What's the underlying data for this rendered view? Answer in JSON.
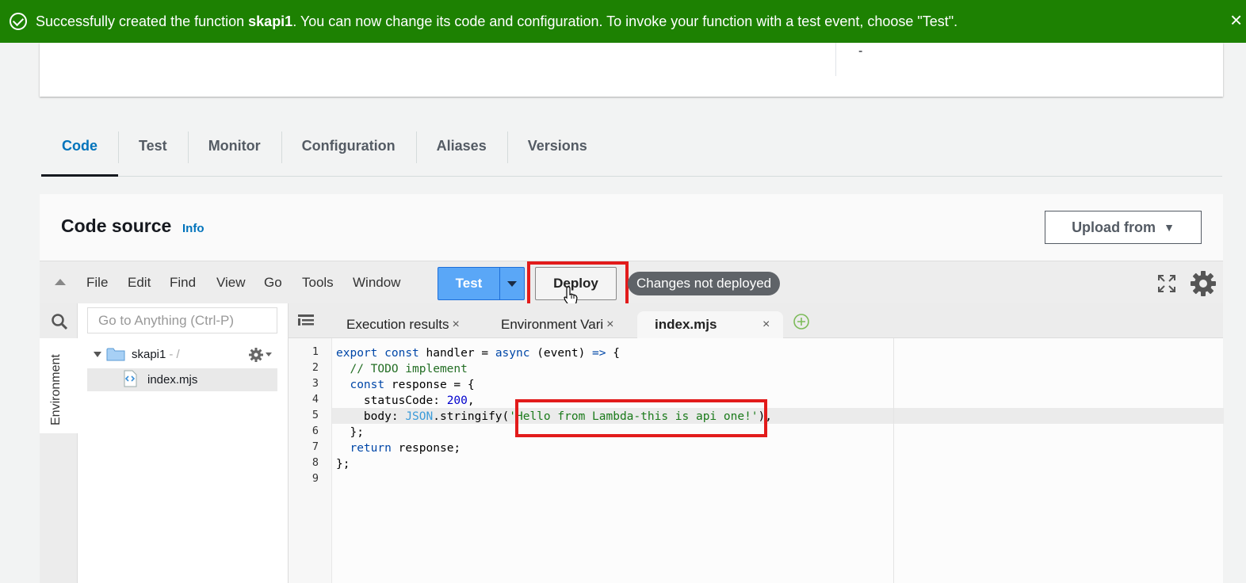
{
  "banner": {
    "prefix": "Successfully created the function ",
    "function_name": "skapi1",
    "suffix": ". You can now change its code and configuration. To invoke your function with a test event, choose \"Test\".",
    "close_label": "×"
  },
  "top_card": {
    "value": "-"
  },
  "tabs": [
    {
      "label": "Code",
      "active": true
    },
    {
      "label": "Test"
    },
    {
      "label": "Monitor"
    },
    {
      "label": "Configuration"
    },
    {
      "label": "Aliases"
    },
    {
      "label": "Versions"
    }
  ],
  "code_source": {
    "title": "Code source",
    "info_link": "Info",
    "upload_label": "Upload from",
    "upload_caret": "▼"
  },
  "menubar": {
    "items": [
      "File",
      "Edit",
      "Find",
      "View",
      "Go",
      "Tools",
      "Window"
    ],
    "test_label": "Test",
    "deploy_label": "Deploy",
    "status": "Changes not deployed"
  },
  "sidebar": {
    "search_placeholder": "Go to Anything (Ctrl-P)",
    "env_label": "Environment",
    "folder_name": "skapi1",
    "folder_suffix": "- /",
    "file_name": "index.mjs"
  },
  "editor_tabs": [
    {
      "label": "Execution results",
      "close": "×"
    },
    {
      "label": "Environment Vari",
      "close": "×"
    },
    {
      "label": "index.mjs",
      "close": "×",
      "active": true
    }
  ],
  "line_numbers": [
    "1",
    "2",
    "3",
    "4",
    "5",
    "6",
    "7",
    "8",
    "9"
  ],
  "code_lines": [
    "export const handler = async (event) => {",
    "  // TODO implement",
    "  const response = {",
    "    statusCode: 200,",
    "    body: JSON.stringify('Hello from Lambda-this is api one!'),",
    "  };",
    "  return response;",
    "};",
    ""
  ],
  "colors": {
    "banner_green": "#1d8102",
    "accent_blue": "#0073bb",
    "test_button_blue": "#5aa7f7",
    "highlight_red": "#e21b1b",
    "status_pill": "#5f6368"
  }
}
